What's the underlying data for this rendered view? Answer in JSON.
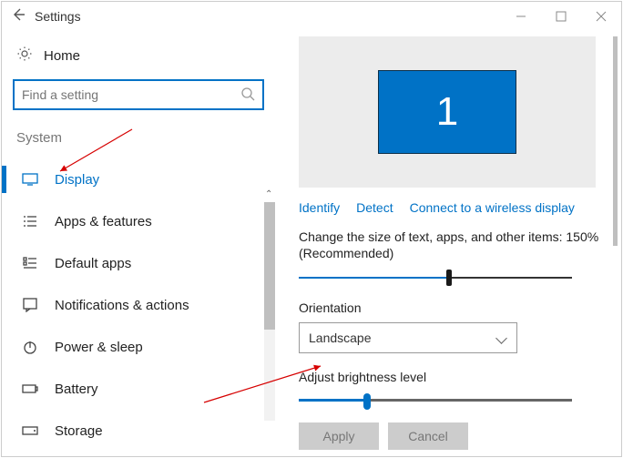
{
  "window": {
    "title": "Settings"
  },
  "sidebar": {
    "home": "Home",
    "search_placeholder": "Find a setting",
    "section": "System",
    "items": [
      {
        "label": "Display",
        "active": true
      },
      {
        "label": "Apps & features"
      },
      {
        "label": "Default apps"
      },
      {
        "label": "Notifications & actions"
      },
      {
        "label": "Power & sleep"
      },
      {
        "label": "Battery"
      },
      {
        "label": "Storage"
      }
    ]
  },
  "display": {
    "monitor_number": "1",
    "links": {
      "identify": "Identify",
      "detect": "Detect",
      "wireless": "Connect to a wireless display"
    },
    "scale_text": "Change the size of text, apps, and other items: 150%",
    "scale_subtext": "(Recommended)",
    "scale_value_pct": 55,
    "orientation_label": "Orientation",
    "orientation_value": "Landscape",
    "brightness_label": "Adjust brightness level",
    "brightness_value_pct": 25,
    "apply": "Apply",
    "cancel": "Cancel"
  }
}
